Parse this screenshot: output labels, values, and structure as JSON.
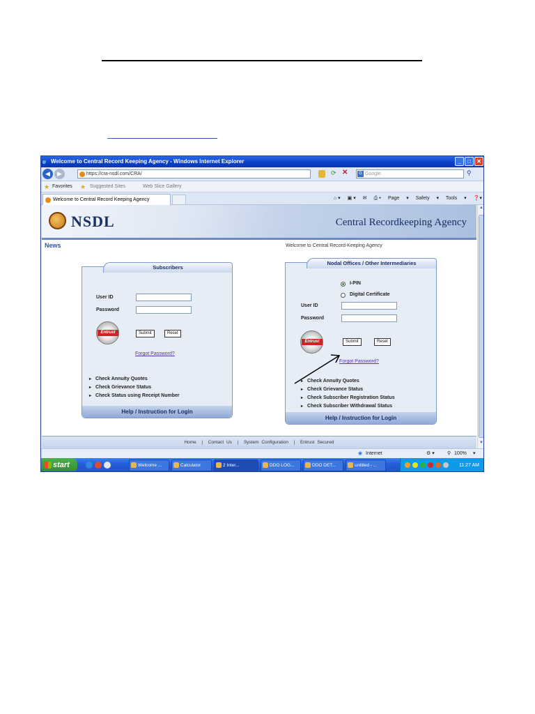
{
  "browser": {
    "title": "Welcome to Central Record Keeping Agency - Windows Internet Explorer",
    "url": "https://cra-nsdl.com/CRA/",
    "search_placeholder": "Google",
    "favorites_label": "Favorites",
    "suggested_sites": "Suggested Sites",
    "web_slice_gallery": "Web Slice Gallery",
    "tab_label": "Welcome to Central Record Keeping Agency",
    "cmd": {
      "page": "Page",
      "safety": "Safety",
      "tools": "Tools"
    },
    "window_buttons": {
      "minimize": "_",
      "maximize": "□",
      "close": "✕"
    }
  },
  "page": {
    "logo": "NSDL",
    "banner_title": "Central Recordkeeping Agency",
    "news": "News",
    "welcome": "Welcome to Central Record-Keeping Agency",
    "subscribers": {
      "title": "Subscribers",
      "user_id_label": "User ID",
      "password_label": "Password",
      "seal": "Entrust",
      "submit": "Submit",
      "reset": "Reset",
      "forgot": "Forgot Password?",
      "links": [
        "Check Annuity Quotes",
        "Check Grievance Status",
        "Check Status using Receipt Number"
      ],
      "help": "Help / Instruction for Login"
    },
    "nodal": {
      "title": "Nodal Offices / Other Intermediaries",
      "options": [
        "I-PIN",
        "Digital Certificate"
      ],
      "selected_option": "I-PIN",
      "user_id_label": "User ID",
      "password_label": "Password",
      "seal": "Entrust",
      "submit": "Submit",
      "reset": "Reset",
      "forgot": "Forgot Password?",
      "links": [
        "Check Annuity Quotes",
        "Check Grievance Status",
        "Check Subscriber Registration Status",
        "Check Subscriber Withdrawal Status"
      ],
      "help": "Help / Instruction for Login"
    },
    "footer_links": [
      "Home",
      "Contact Us",
      "System Configuration",
      "Entrust Secured"
    ],
    "footer_sep": "|"
  },
  "status": {
    "zone": "Internet",
    "zoom": "100%"
  },
  "taskbar": {
    "start": "start",
    "tasks": [
      "Welcome ...",
      "Calculator",
      "2 Inter...",
      "DDO LOG...",
      "DDO DET...",
      "untitled - ..."
    ],
    "active_task": "2 Inter...",
    "clock": "11:27 AM"
  },
  "colors": {
    "title_bar": "#0a3fc7",
    "banner_text": "#1b2e62",
    "taskbar": "#245edb",
    "start": "#318a31"
  }
}
